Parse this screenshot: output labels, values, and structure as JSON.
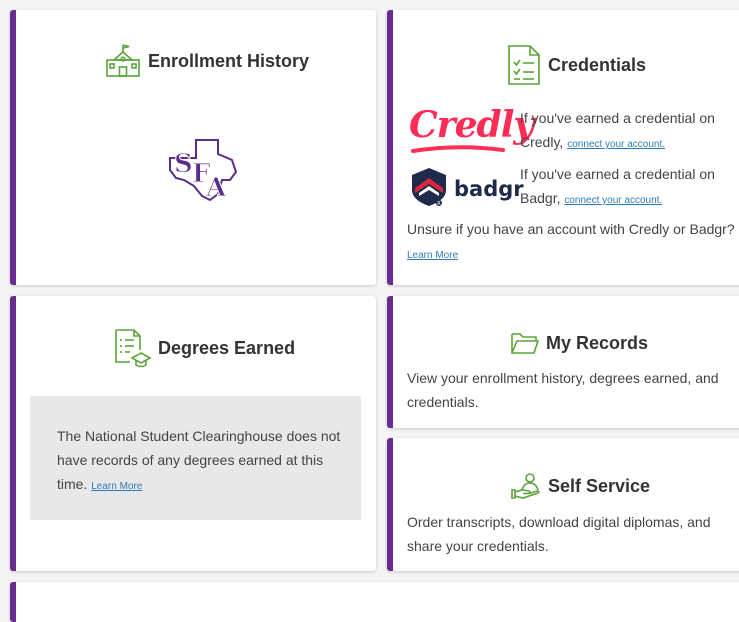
{
  "enrollment": {
    "title": "Enrollment History",
    "logo_text": "SFA"
  },
  "credentials": {
    "title": "Credentials",
    "credly_logo": "Credly",
    "credly_text": "If you've earned a credential on Credly,",
    "credly_link": "connect your account.",
    "badgr_logo": "badgr",
    "badgr_text": "If you've earned a credential on Badgr,",
    "badgr_link": "connect your account.",
    "unsure_text": "Unsure if you have an account with Credly or Badgr?",
    "learn_more": "Learn More"
  },
  "degrees": {
    "title": "Degrees Earned",
    "message": "The National Student Clearinghouse does not have records of any degrees earned at this time.",
    "learn_more": "Learn More"
  },
  "records": {
    "title": "My Records",
    "description": "View your enrollment history, degrees earned, and credentials."
  },
  "self_service": {
    "title": "Self Service",
    "description": "Order transcripts, download digital diplomas, and share your credentials."
  },
  "colors": {
    "accent": "#6b2c91",
    "icon": "#5aa33b",
    "credly": "#ff2d55",
    "badgr_red": "#d7263d",
    "badgr_navy": "#1d2a4a",
    "link": "#2f7bb5"
  }
}
